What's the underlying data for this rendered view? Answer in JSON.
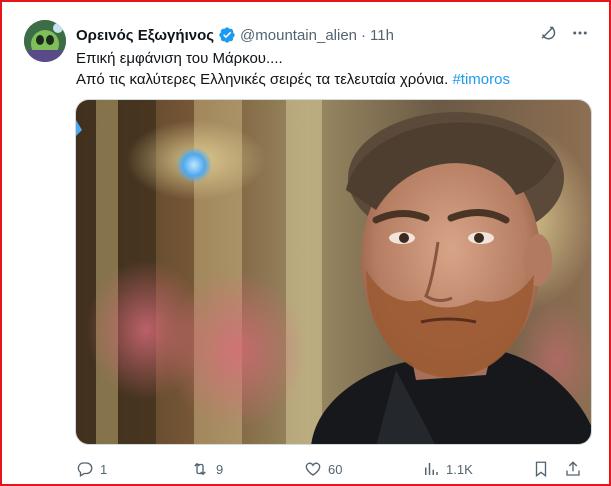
{
  "tweet": {
    "author_name": "Ορεινός Εξωγήινος",
    "handle": "@mountain_alien",
    "separator": "·",
    "time": "11h",
    "line1": "Επική εμφάνιση του Μάρκου....",
    "line2": "Από τις καλύτερες Ελληνικές σειρές τα τελευταία χρόνια. ",
    "hashtag": "#timoros",
    "verified": true,
    "accent_color": "#1d9bf0"
  },
  "header_icons": [
    "grok-icon",
    "more-icon"
  ],
  "actions": {
    "replies": "1",
    "reposts": "9",
    "likes": "60",
    "views": "1.1K"
  },
  "frame_color": "#e8141c"
}
